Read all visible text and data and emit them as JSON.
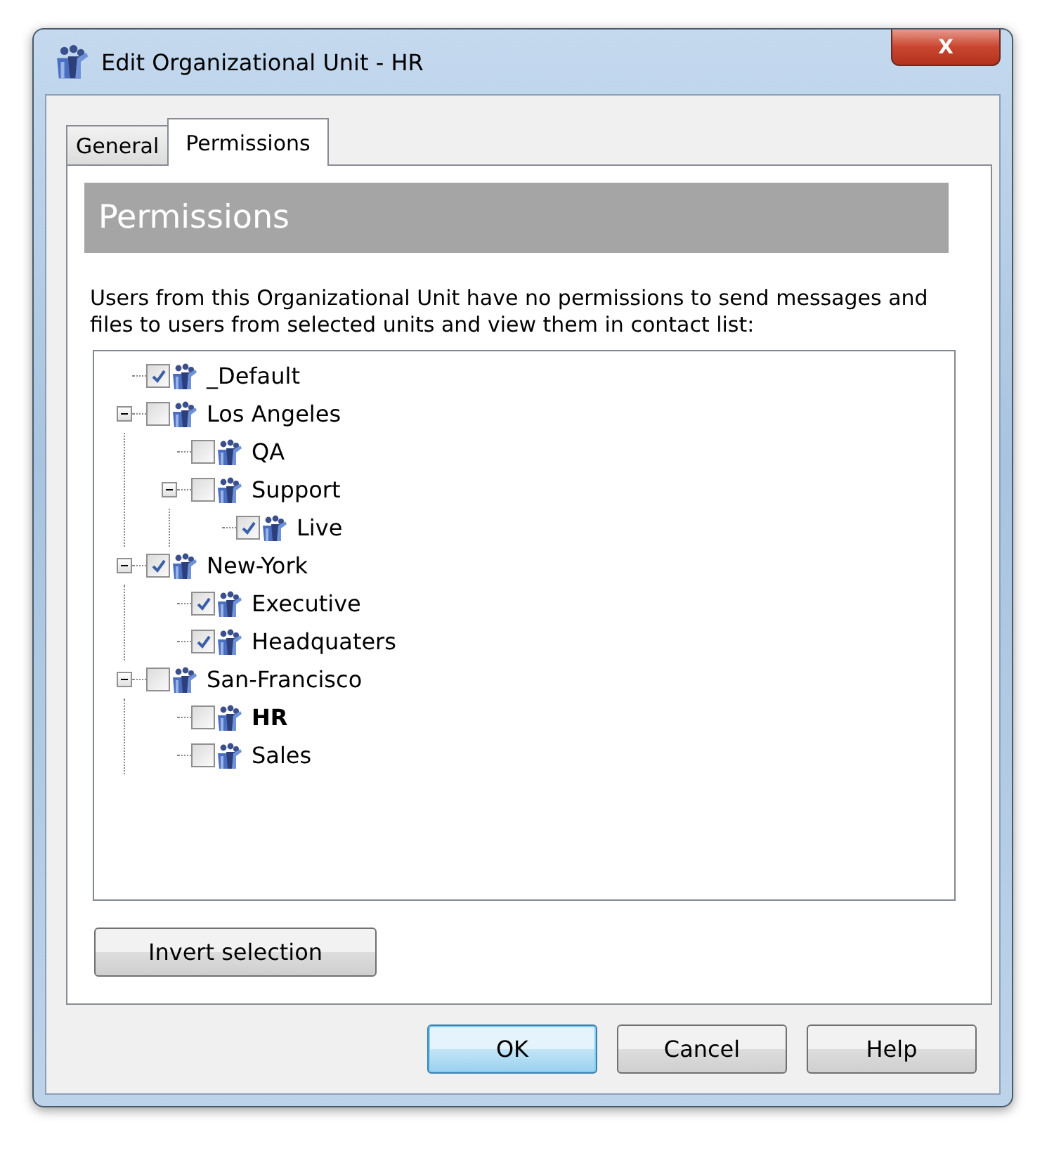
{
  "window": {
    "title": "Edit Organizational Unit - HR",
    "close_label": "X"
  },
  "tabs": [
    {
      "label": "General",
      "selected": false
    },
    {
      "label": "Permissions",
      "selected": true
    }
  ],
  "panel": {
    "header": "Permissions",
    "description": "Users from this Organizational Unit have no permissions to send messages and files to users from selected units and view them in contact list:"
  },
  "tree": [
    {
      "label": "_Default",
      "checked": true,
      "current": false
    },
    {
      "label": "Los Angeles",
      "checked": false,
      "current": false,
      "expanded": true,
      "children": [
        {
          "label": "QA",
          "checked": false,
          "current": false
        },
        {
          "label": "Support",
          "checked": false,
          "current": false,
          "expanded": true,
          "children": [
            {
              "label": "Live",
              "checked": true,
              "current": false
            }
          ]
        }
      ]
    },
    {
      "label": "New-York",
      "checked": true,
      "current": false,
      "expanded": true,
      "children": [
        {
          "label": "Executive",
          "checked": true,
          "current": false
        },
        {
          "label": "Headquaters",
          "checked": true,
          "current": false
        }
      ]
    },
    {
      "label": "San-Francisco",
      "checked": false,
      "current": false,
      "expanded": true,
      "children": [
        {
          "label": "HR",
          "checked": false,
          "current": true
        },
        {
          "label": "Sales",
          "checked": false,
          "current": false
        }
      ]
    }
  ],
  "invert_button": "Invert selection",
  "buttons": [
    {
      "label": "OK",
      "default": true
    },
    {
      "label": "Cancel",
      "default": false
    },
    {
      "label": "Help",
      "default": false
    }
  ]
}
